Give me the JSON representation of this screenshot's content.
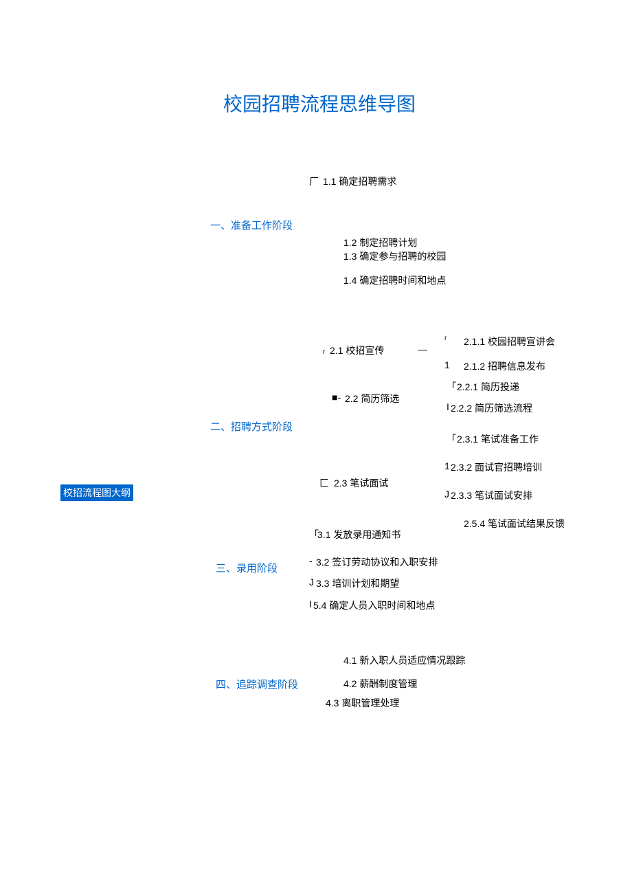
{
  "title": "校园招聘流程思维导图",
  "root": "校招流程图大纲",
  "branches": {
    "b1": {
      "label": "一、准备工作阶段",
      "items": {
        "i1": {
          "prefix": "厂",
          "text": "1.1 确定招聘需求"
        },
        "i2": {
          "text": "1.2   制定招聘计划"
        },
        "i3": {
          "text": "1.3   确定参与招聘的校园"
        },
        "i4": {
          "text": "1.4   确定招聘时间和地点"
        }
      }
    },
    "b2": {
      "label": "二、招聘方式阶段",
      "items": {
        "i1": {
          "prefix": "r",
          "text": "2.1 校招宣传",
          "suffix": "—",
          "sub": {
            "s1": {
              "prefix": "r",
              "text": "2.1.1 校园招聘宣讲会"
            },
            "s2": {
              "prefix": "1",
              "text": "2.1.2 招聘信息发布"
            }
          }
        },
        "i2": {
          "prefix": "■-",
          "text": "2.2 简历筛选",
          "sub": {
            "s1": {
              "prefix": "「",
              "text": "2.2.1 简历投递"
            },
            "s2": {
              "prefix": "I",
              "text": "2.2.2 简历筛选流程"
            }
          }
        },
        "i3": {
          "prefix": "匚",
          "text": "2.3 笔试面试",
          "sub": {
            "s1": {
              "prefix": "「",
              "text": "2.3.1 笔试准备工作"
            },
            "s2": {
              "prefix": "1",
              "text": "2.3.2 面试官招聘培训"
            },
            "s3": {
              "prefix": "J",
              "text": "2.3.3 笔试面试安排"
            },
            "s4": {
              "text": "2.5.4 笔试面试结果反馈"
            }
          }
        }
      }
    },
    "b3": {
      "label": "三、录用阶段",
      "items": {
        "i1": {
          "prefix": "「",
          "text": "3.1 发放录用通知书"
        },
        "i2": {
          "prefix": "-",
          "text": "3.2 签订劳动协议和入职安排"
        },
        "i3": {
          "prefix": "J",
          "text": "3.3 培训计划和期望"
        },
        "i4": {
          "prefix": "I",
          "text": "5.4 确定人员入职时间和地点"
        }
      }
    },
    "b4": {
      "label": "四、追踪调查阶段",
      "items": {
        "i1": {
          "text": "4.1   新入职人员适应情况跟踪"
        },
        "i2": {
          "text": "4.2   薪酬制度管理"
        },
        "i3": {
          "text": "4.3 离职管理处理"
        }
      }
    }
  }
}
